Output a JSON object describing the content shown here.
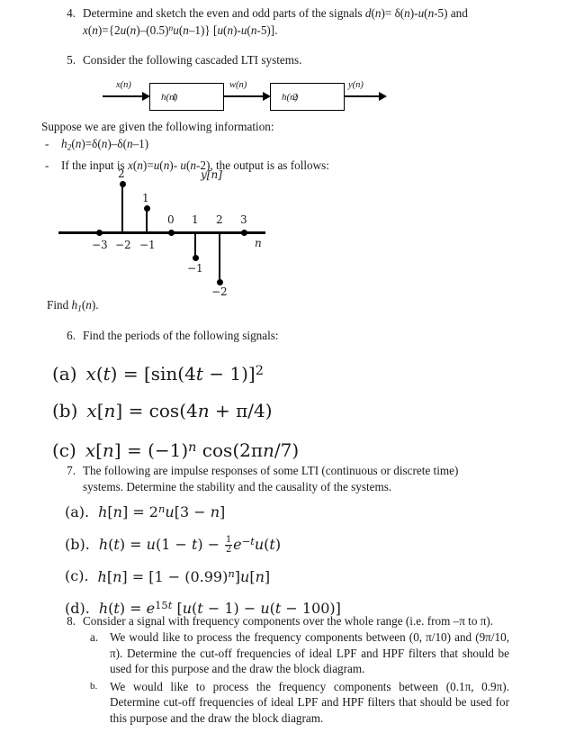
{
  "q4": {
    "number": "4.",
    "line1_a": "Determine and sketch the even and odd parts of the signals ",
    "line1_b": "d",
    "line1_c": "(",
    "line1_d": "n",
    "line1_e": ")= δ(",
    "line1_f": "n",
    "line1_g": ")-",
    "line1_h": "u",
    "line1_i": "(",
    "line1_j": "n",
    "line1_k": "-5) and",
    "line2": "x(n)={2u(n)–(0.5)ⁿu(n–1)} [u(n)-u(n-5)]."
  },
  "q5": {
    "number": "5.",
    "heading": "Consider the following cascaded LTI systems.",
    "diagram": {
      "input_label": "x(n)",
      "mid_label": "w(n)",
      "output_label": "y(n)",
      "box1_label": "h₁(n)",
      "box2_label": "h₂(n)"
    },
    "suppose": "Suppose we are given the following information:",
    "bullets": [
      {
        "mark": "-",
        "text": "h₂(n)=δ(n)–δ(n–1)"
      },
      {
        "mark": "-",
        "text": "If the input is x(n)=u(n)- u(n-2), the output is as follows:"
      }
    ],
    "plot": {
      "title": "y[n]",
      "xlabel": "n",
      "tick_labels_left": [
        "−3",
        "−2",
        "−1"
      ],
      "tick_labels_right": [
        "0",
        "1",
        "2",
        "3"
      ],
      "value_labels": [
        "2",
        "1",
        "−1",
        "−2"
      ]
    },
    "find": "Find h₁(n)."
  },
  "q6": {
    "number": "6.",
    "heading": "Find the periods of the following signals:",
    "items": [
      {
        "label": "(a)",
        "expr": "x(t) = [sin(4t − 1)]²"
      },
      {
        "label": "(b)",
        "expr": "x[n] = cos(4n + π/4)"
      },
      {
        "label": "(c)",
        "expr": "x[n] = (−1)ⁿ cos(2πn/7)"
      }
    ]
  },
  "q7": {
    "number": "7.",
    "heading_line1": "The following are impulse responses of some LTI (continuous or discrete time)",
    "heading_line2": "systems. Determine the stability and the causality of the systems.",
    "items": [
      {
        "label": "(a).",
        "expr": "h[n] = 2ⁿu[3 − n]"
      },
      {
        "label": "(b).",
        "expr": "h(t) = u(1 − t) − ½e⁻ᵗu(t)"
      },
      {
        "label": "(c).",
        "expr": "h[n] = [1 − (0.99)ⁿ]u[n]"
      },
      {
        "label": "(d).",
        "expr": "h(t) = e¹⁵ᵗ [u(t − 1) − u(t − 100)]"
      }
    ]
  },
  "q8": {
    "number": "8.",
    "heading": "Consider a signal with frequency components over the whole range (i.e. from –π to π).",
    "items": [
      {
        "label": "a.",
        "text": "We would like to process the frequency components between (0, π/10) and (9π/10, π). Determine the cut-off frequencies of ideal LPF and HPF filters that should be used for this purpose and the draw the block diagram."
      },
      {
        "label": "b.",
        "text": "We would like to process the frequency components between (0.1π, 0.9π). Determine cut-off frequencies of ideal LPF and HPF filters that should be used for this purpose and the draw the block diagram."
      }
    ]
  },
  "chart_data": {
    "type": "stem",
    "title": "y[n]",
    "xlabel": "n",
    "ylabel": "",
    "x": [
      -3,
      -2,
      -1,
      0,
      1,
      2,
      3
    ],
    "values": [
      0,
      2,
      1,
      0,
      -1,
      -2,
      0
    ],
    "xlim": [
      -3.8,
      3.8
    ],
    "ylim": [
      -2.4,
      2.4
    ],
    "grid": false,
    "legend": "none"
  }
}
